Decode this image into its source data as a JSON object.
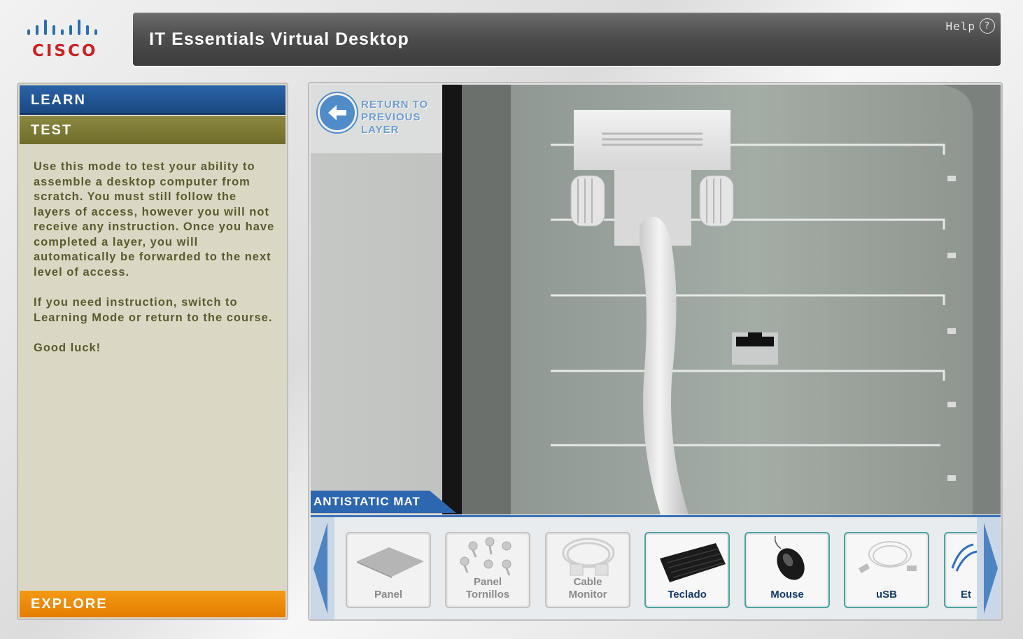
{
  "brand": {
    "logo_text": "CISCO"
  },
  "header": {
    "title": "IT Essentials Virtual Desktop",
    "help_label": "Help",
    "help_icon": "?"
  },
  "sidebar": {
    "tabs": {
      "learn": "LEARN",
      "test": "TEST",
      "explore": "EXPLORE"
    },
    "description": [
      "Use this mode to test your ability to assemble a desktop computer from scratch. You must still follow the layers of access, however you will not receive any instruction. Once you have completed a layer, you will automatically be forwarded to the next level of access.",
      "If you need instruction, switch to Learning Mode or return to the course.",
      "Good luck!"
    ]
  },
  "viewport": {
    "return_label_line1": "RETURN TO",
    "return_label_line2": "PREVIOUS LAYER",
    "section_label": "ANTISTATIC MAT"
  },
  "tray": {
    "items": [
      {
        "label": "Panel",
        "icon": "panel-icon",
        "active": false
      },
      {
        "label": "Panel\nTornillos",
        "icon": "screws-icon",
        "active": false
      },
      {
        "label": "Cable\nMonitor",
        "icon": "monitor-cable-icon",
        "active": false
      },
      {
        "label": "Teclado",
        "icon": "keyboard-icon",
        "active": true
      },
      {
        "label": "Mouse",
        "icon": "mouse-icon",
        "active": true
      },
      {
        "label": "uSB",
        "icon": "usb-cable-icon",
        "active": true
      },
      {
        "label": "Et",
        "icon": "ethernet-cable-icon",
        "active": true
      }
    ]
  },
  "colors": {
    "learn": "#1f5394",
    "test": "#7d7b37",
    "explore": "#f08c0c",
    "accent_blue": "#2d67b0",
    "logo_red": "#cc2222"
  }
}
